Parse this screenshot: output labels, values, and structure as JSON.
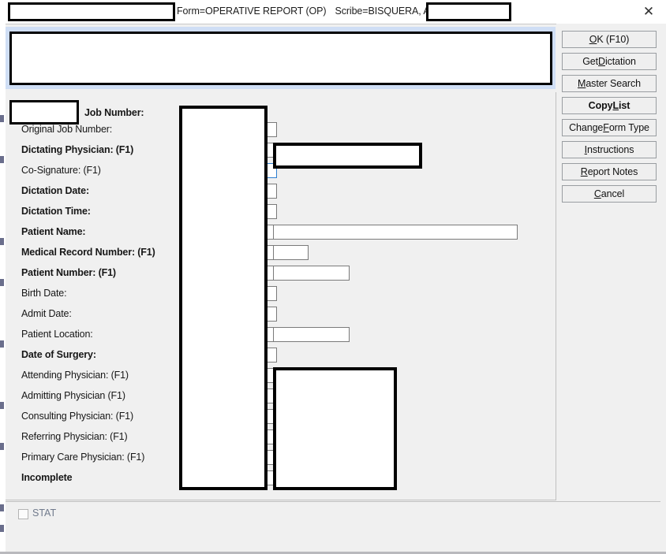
{
  "window": {
    "form_label": "Form=OPERATIVE REPORT (OP)",
    "scribe_label": "Scribe=BISQUERA, ALAINE",
    "close_icon": "close-icon",
    "title_value": "",
    "scribe_value": ""
  },
  "dictation": {
    "text_value": ""
  },
  "job": {
    "number_value": "",
    "number_label": "Job Number:"
  },
  "fields": [
    {
      "label": "Original Job Number:",
      "bold": false,
      "input": "narrow",
      "value": ""
    },
    {
      "label": "Dictating Physician: (F1)",
      "bold": true,
      "input": "wide",
      "value": ""
    },
    {
      "label": "Co-Signature: (F1)",
      "bold": false,
      "input": "focused",
      "value": ""
    },
    {
      "label": "Dictation Date:",
      "bold": true,
      "input": "date",
      "value": ""
    },
    {
      "label": "Dictation Time:",
      "bold": true,
      "input": "date",
      "value": ""
    },
    {
      "label": "Patient Name:",
      "bold": true,
      "input": "xwide",
      "value": ""
    },
    {
      "label": "Medical Record Number: (F1)",
      "bold": true,
      "input": "mid",
      "value": ""
    },
    {
      "label": "Patient Number: (F1)",
      "bold": true,
      "input": "mid2",
      "value": ""
    },
    {
      "label": "Birth Date:",
      "bold": false,
      "input": "date",
      "value": ""
    },
    {
      "label": "Admit Date:",
      "bold": false,
      "input": "date",
      "value": ""
    },
    {
      "label": "Patient Location:",
      "bold": false,
      "input": "mid2",
      "value": ""
    },
    {
      "label": "Date of Surgery:",
      "bold": true,
      "input": "date",
      "value": ""
    },
    {
      "label": "Attending Physician: (F1)",
      "bold": false,
      "input": "wide",
      "value": ""
    },
    {
      "label": "Admitting Physician (F1)",
      "bold": false,
      "input": "wide",
      "value": ""
    },
    {
      "label": "Consulting Physician: (F1)",
      "bold": false,
      "input": "wide",
      "value": ""
    },
    {
      "label": "Referring Physician: (F1)",
      "bold": false,
      "input": "wide",
      "value": ""
    },
    {
      "label": "Primary Care Physician: (F1)",
      "bold": false,
      "input": "wide",
      "value": ""
    },
    {
      "label": "Incomplete",
      "bold": true,
      "input": "wide",
      "value": ""
    }
  ],
  "buttons": [
    {
      "pre": "",
      "accel": "O",
      "post": "K  (F10)",
      "bold": false
    },
    {
      "pre": "Get ",
      "accel": "D",
      "post": "ictation",
      "bold": false
    },
    {
      "pre": "",
      "accel": "M",
      "post": "aster Search",
      "bold": false
    },
    {
      "pre": "Copy ",
      "accel": "L",
      "post": "ist",
      "bold": true
    },
    {
      "pre": "Change ",
      "accel": "F",
      "post": "orm Type",
      "bold": false
    },
    {
      "pre": "",
      "accel": "I",
      "post": "nstructions",
      "bold": false
    },
    {
      "pre": "",
      "accel": "R",
      "post": "eport Notes",
      "bold": false
    },
    {
      "pre": "",
      "accel": "C",
      "post": "ancel",
      "bold": false
    }
  ],
  "footer": {
    "stat_label": "STAT",
    "stat_checked": false
  },
  "colors": {
    "band_blue": "#cfdef5",
    "surface": "#f0f0f0",
    "button_face": "#efefef",
    "disabled_text": "#707a8c"
  }
}
